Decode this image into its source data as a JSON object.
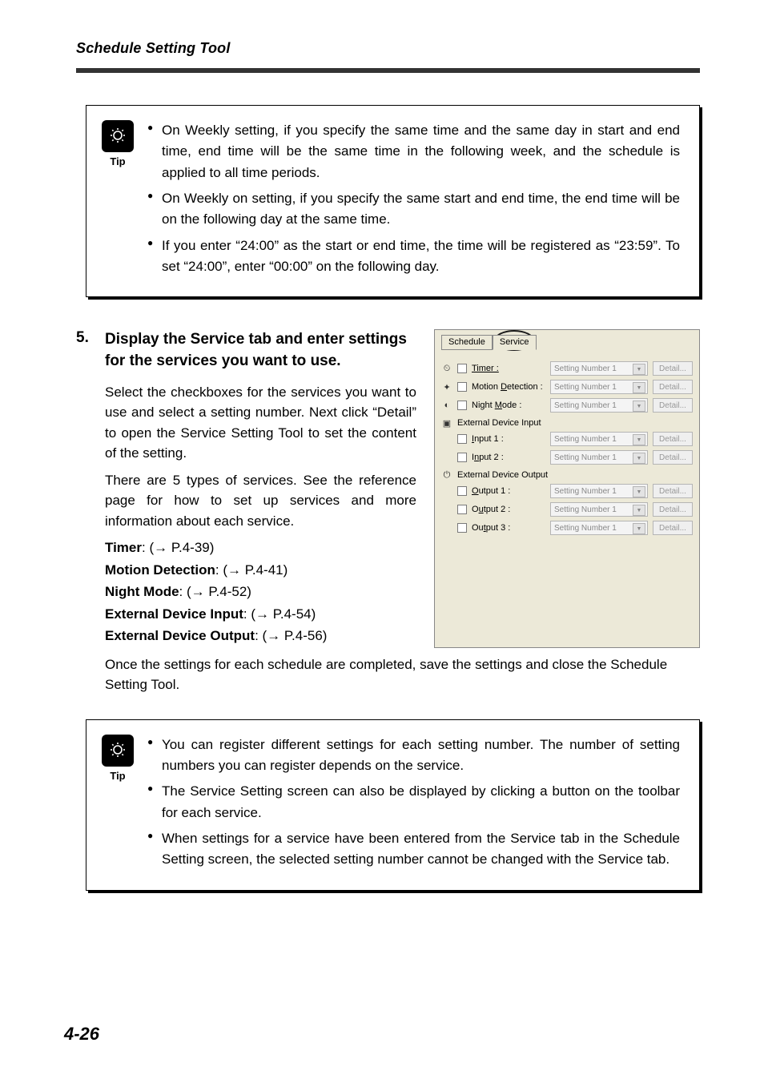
{
  "header": {
    "running_head": "Schedule Setting Tool"
  },
  "tip1": {
    "label": "Tip",
    "items": [
      "On Weekly setting, if you specify the same time and the same day in start and end time, end time will be the same time in the following week, and the schedule is applied to all time periods.",
      "On Weekly on setting, if you specify the same start and end time, the end time will be on the following day at the same time.",
      "If you enter “24:00” as the start or end time, the time will be registered as “23:59”. To set “24:00”, enter “00:00” on the following day."
    ]
  },
  "step": {
    "num": "5.",
    "title": "Display the Service tab and enter settings for the services you want to use.",
    "para1": "Select the checkboxes for the services you want to use and select a setting number. Next click “Detail” to open the Service Setting Tool to set the content of the setting.",
    "para2": "There are 5 types of services. See the reference page for how to set up services and more information about each service.",
    "refs": {
      "timer_b": "Timer",
      "timer_t": ": (→ P.4-39)",
      "motion_b": "Motion Detection",
      "motion_t": ": (→ P.4-41)",
      "night_b": "Night Mode",
      "night_t": ": (→ P.4-52)",
      "edi_b": "External Device Input",
      "edi_t": ": (→ P.4-54)",
      "edo_b": "External Device Output",
      "edo_t": ": (→ P.4-56)"
    },
    "after": "Once the settings for each schedule are completed, save the settings and close the Schedule Setting Tool."
  },
  "panel": {
    "tabs": {
      "schedule": "Schedule",
      "service": "Service"
    },
    "setting": "Setting Number 1",
    "detail": "Detail...",
    "rows": {
      "timer": "Timer :",
      "motion_pre": "Motion ",
      "motion_ul": "D",
      "motion_post": "etection :",
      "night_pre": "Night ",
      "night_ul": "M",
      "night_post": "ode :",
      "edi_group": "External Device Input",
      "in1_ul": "I",
      "in1_post": "nput 1 :",
      "in2_pre": "I",
      "in2_ul": "n",
      "in2_post": "put 2 :",
      "edo_group": "External Device Output",
      "out1_ul": "O",
      "out1_post": "utput 1 :",
      "out2_pre": "O",
      "out2_ul": "u",
      "out2_post": "tput 2 :",
      "out3_pre": "Ou",
      "out3_ul": "t",
      "out3_post": "put 3 :"
    }
  },
  "tip2": {
    "label": "Tip",
    "items": [
      "You can register different settings for each setting number. The number of setting numbers you can register depends on the service.",
      "The Service Setting screen can also be displayed by clicking a button on the toolbar for each service.",
      "When settings for a service have been entered from the Service tab in the Schedule Setting screen, the selected setting number cannot be changed with the Service tab."
    ]
  },
  "page_num": "4-26"
}
